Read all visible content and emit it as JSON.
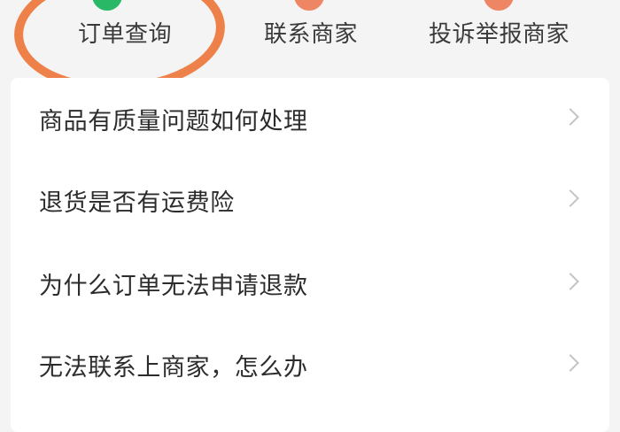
{
  "top_actions": {
    "order_query": {
      "label": "订单查询",
      "icon": "order-icon",
      "icon_color": "#29b866"
    },
    "contact_merchant": {
      "label": "联系商家",
      "icon": "chat-icon",
      "icon_color": "#ef8663"
    },
    "report_merchant": {
      "label": "投诉举报商家",
      "icon": "report-icon",
      "icon_color": "#ef8663"
    },
    "highlight_color": "#ee8149"
  },
  "faq": {
    "items": [
      {
        "label": "商品有质量问题如何处理"
      },
      {
        "label": "退货是否有运费险"
      },
      {
        "label": "为什么订单无法申请退款"
      },
      {
        "label": "无法联系上商家，怎么办"
      }
    ]
  },
  "colors": {
    "background": "#f4f4f4",
    "card": "#ffffff",
    "text": "#2c2c2c",
    "chevron": "#c4c4c4"
  }
}
